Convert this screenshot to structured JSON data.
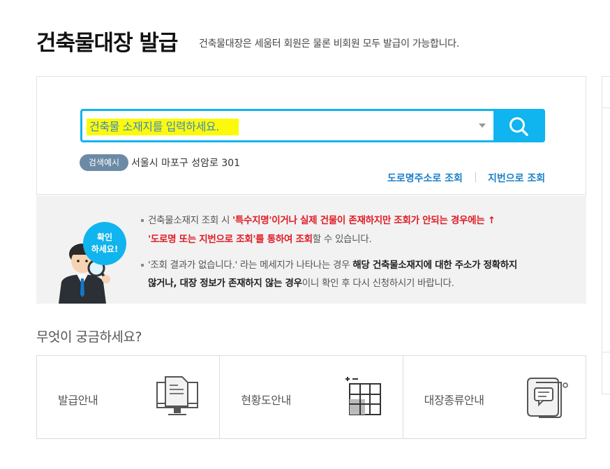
{
  "header": {
    "title": "건축물대장 발급",
    "subtitle": "건축물대장은 세움터 회원은 물론 비회원 모두 발급이 가능합니다."
  },
  "search": {
    "placeholder": "건축물 소재지를 입력하세요.",
    "example_badge": "검색예시",
    "example_text": "서울시 마포구 성암로 301",
    "road_link": "도로명주소로 조회",
    "lot_link": "지번으로 조회",
    "accent_color": "#10b4ee",
    "highlight_color": "#fdf90a"
  },
  "notice": {
    "bubble_line1": "확인",
    "bubble_line2": "하세요!",
    "line1_a": "건축물소재지 조회 시 ",
    "line1_b": "'특수지명'이거나 실제 건물이 존재하지만 조회가 안되는 경우에는 ↑",
    "line2_a": "'도로명 또는 지번으로 조회'를 통하여 조회",
    "line2_b": "할 수 있습니다.",
    "line3_a": "'조회 결과가 없습니다.' 라는 메세지가 나타나는 경우 ",
    "line3_b": "해당 건축물소재지에 대한 주소가 정확하지",
    "line4_a": "않거나, 대장 정보가 존재하지 않는 경우",
    "line4_b": "이니 확인 후 다시 신청하시기 바랍니다."
  },
  "faq": {
    "title": "무엇이 궁금하세요?",
    "cards": [
      {
        "label": "발급안내",
        "icon": "monitor-document-icon"
      },
      {
        "label": "현황도안내",
        "icon": "floor-plan-icon"
      },
      {
        "label": "대장종류안내",
        "icon": "scroll-document-icon"
      }
    ]
  }
}
